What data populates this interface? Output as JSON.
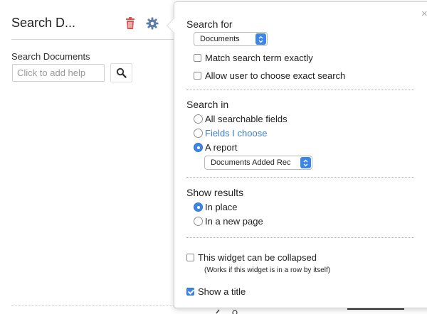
{
  "widget": {
    "title": "Search D...",
    "search_label": "Search Documents",
    "search_placeholder": "Click to add help",
    "search_icon": "magnifier-icon",
    "trash_icon": "trash-icon",
    "settings_icon": "gear-icon",
    "trash_color": "#d9534f",
    "gear_color": "#5d7ea8"
  },
  "popover": {
    "close_label": "×",
    "search_for": {
      "heading": "Search for",
      "select_value": "Documents",
      "options": [
        {
          "label": "Match search term exactly",
          "checked": false
        },
        {
          "label": "Allow user to choose exact search",
          "checked": false
        }
      ]
    },
    "search_in": {
      "heading": "Search in",
      "options": [
        {
          "label": "All searchable fields",
          "selected": false
        },
        {
          "label": "Fields I choose",
          "selected": false
        },
        {
          "label": "A report",
          "selected": true
        }
      ],
      "report_value": "Documents Added Rec"
    },
    "show_results": {
      "heading": "Show results",
      "options": [
        {
          "label": "In place",
          "selected": true
        },
        {
          "label": "In a new page",
          "selected": false
        }
      ]
    },
    "collapsible": {
      "label": "This widget can be collapsed",
      "note": "(Works if this widget is in a row by itself)",
      "checked": false
    },
    "show_title": {
      "label": "Show a title",
      "checked": true
    }
  },
  "colors": {
    "accent": "#3b86e6",
    "link": "#3b7dd8"
  }
}
